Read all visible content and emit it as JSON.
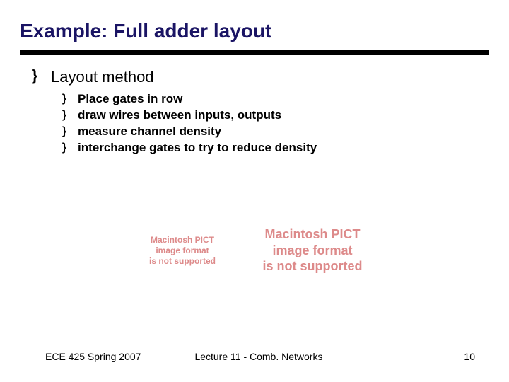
{
  "title": "Example: Full adder layout",
  "main_bullet": {
    "glyph": "}",
    "label": "Layout method"
  },
  "sub_bullets": [
    {
      "glyph": "}",
      "label": "Place gates in row"
    },
    {
      "glyph": "}",
      "label": "draw wires between inputs, outputs"
    },
    {
      "glyph": "}",
      "label": "measure channel density"
    },
    {
      "glyph": "}",
      "label": "interchange gates to try to reduce density"
    }
  ],
  "image_placeholders": {
    "small": "Macintosh PICT\nimage format\nis not supported",
    "large": "Macintosh PICT\nimage format\nis not supported"
  },
  "footer": {
    "left": "ECE 425 Spring 2007",
    "center": "Lecture 11 - Comb. Networks",
    "right": "10"
  }
}
